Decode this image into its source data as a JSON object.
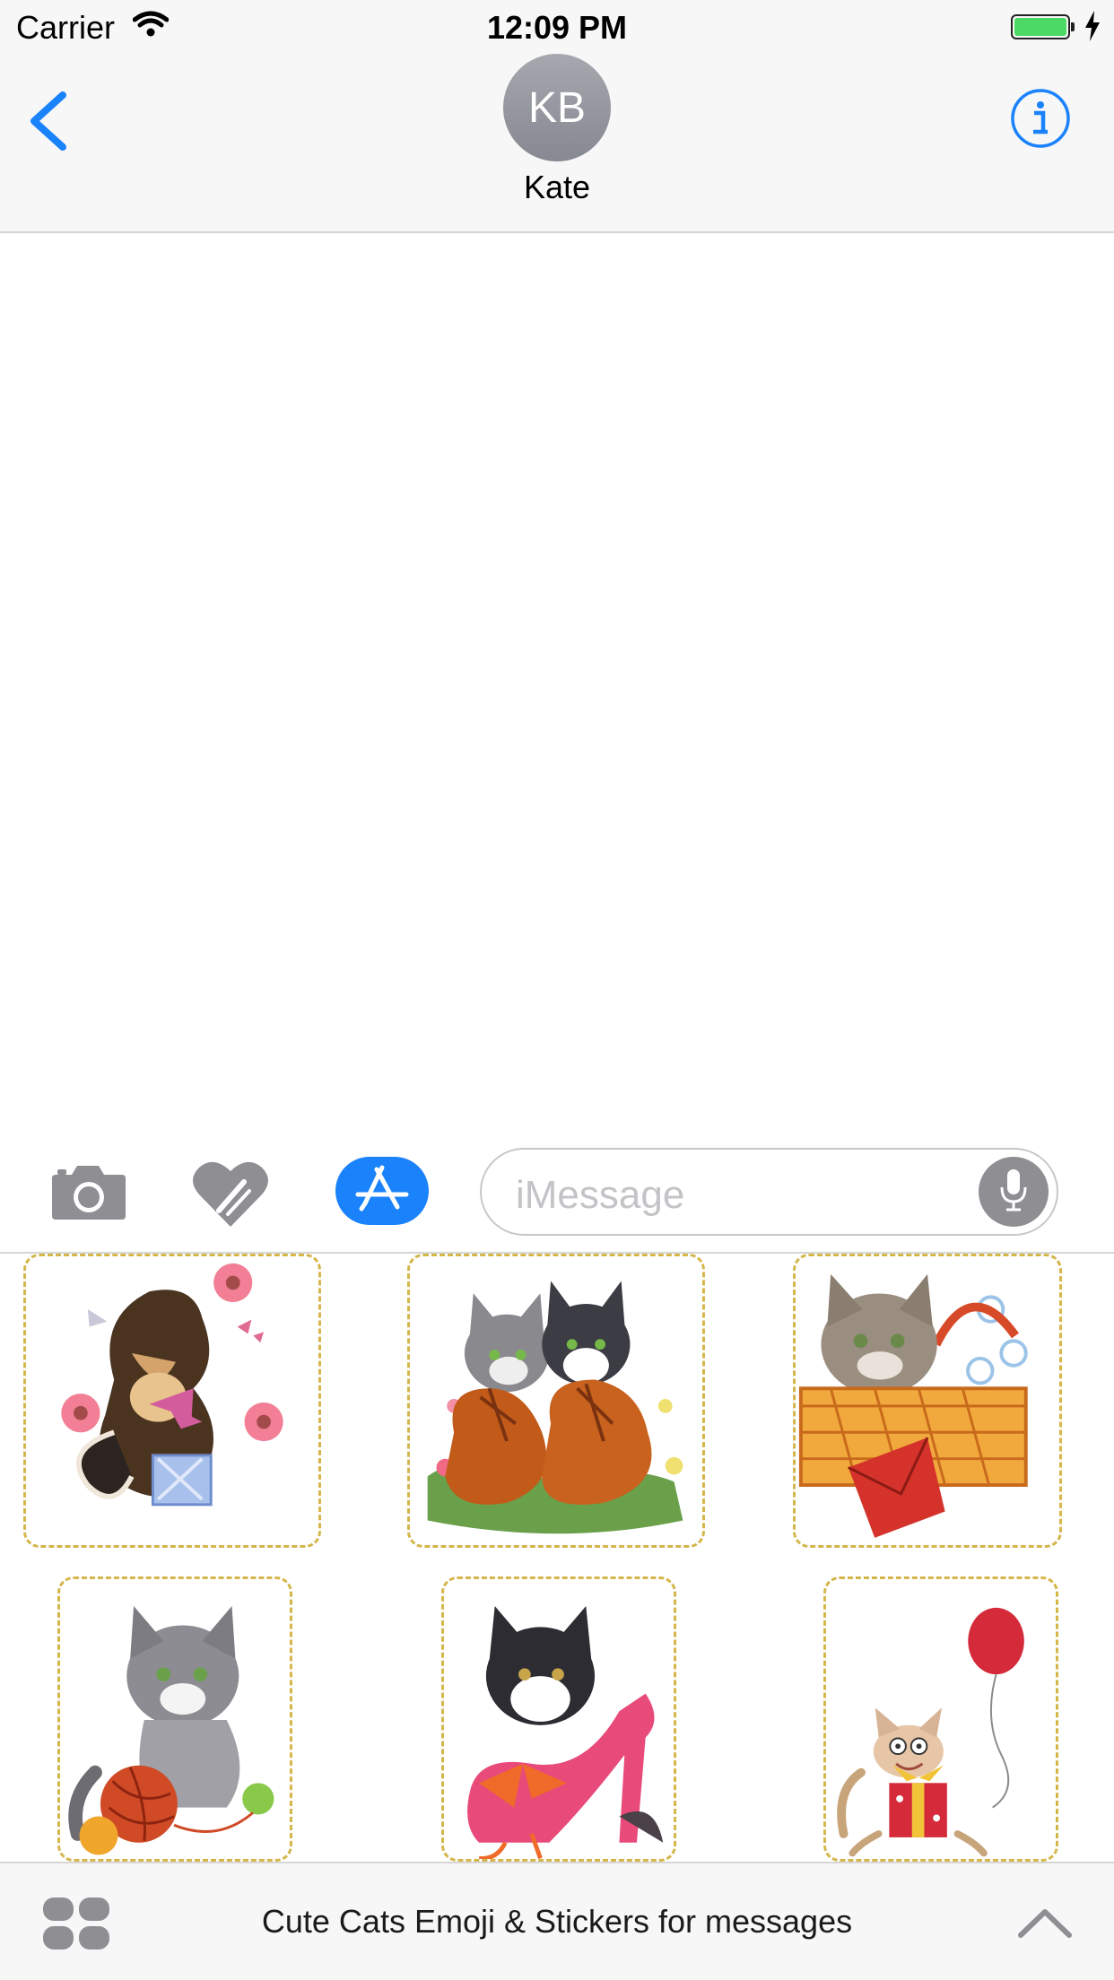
{
  "status": {
    "carrier": "Carrier",
    "time": "12:09 PM",
    "battery_color": "#4cd964"
  },
  "nav": {
    "avatar_initials": "KB",
    "contact_name": "Kate",
    "accent": "#1a82fb"
  },
  "input": {
    "placeholder": "iMessage"
  },
  "stickers": [
    {
      "name": "sticker-puppy-flowers",
      "subject": "puppy with flowers and gift"
    },
    {
      "name": "sticker-kittens-boots",
      "subject": "two kittens in orange boots"
    },
    {
      "name": "sticker-kitten-basket",
      "subject": "kitten in basket with envelope"
    },
    {
      "name": "sticker-kitten-yarn",
      "subject": "grey kitten with yarn balls"
    },
    {
      "name": "sticker-kitten-shoe",
      "subject": "kitten in pink shoe"
    },
    {
      "name": "sticker-cat-balloon",
      "subject": "cat with red balloon and gift"
    }
  ],
  "bottom": {
    "app_name": "Cute Cats Emoji & Stickers for messages"
  }
}
